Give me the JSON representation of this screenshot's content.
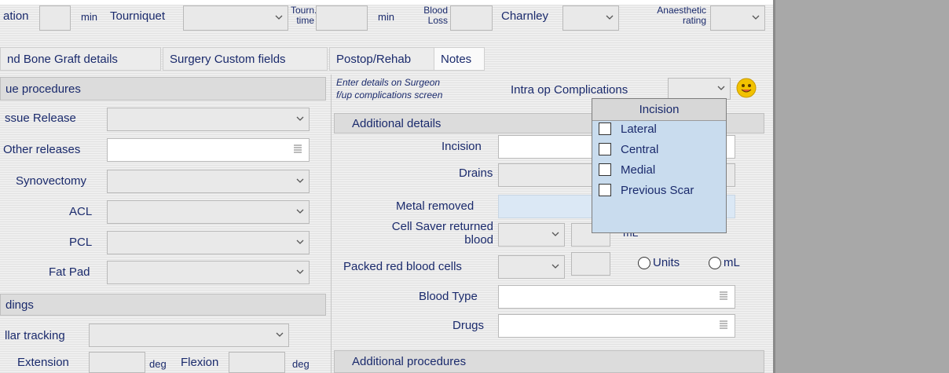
{
  "top_row": {
    "duration_label_fragment": "ation",
    "min_label_1": "min",
    "tourniquet_label": "Tourniquet",
    "tourn_time_label": "Tourn.\ntime",
    "min_label_2": "min",
    "blood_loss_label": "Blood\nLoss",
    "charnley_label": "Charnley",
    "anaesthetic_rating_label": "Anaesthetic\nrating"
  },
  "tabs": [
    {
      "label": "nd Bone Graft details"
    },
    {
      "label": "Surgery Custom fields"
    },
    {
      "label": "Postop/Rehab"
    },
    {
      "label": "Notes"
    }
  ],
  "soft_tissue": {
    "section_title": "ue procedures",
    "rows": [
      {
        "label": "ssue Release"
      },
      {
        "label": "Other releases"
      },
      {
        "label": "Synovectomy"
      },
      {
        "label": "ACL"
      },
      {
        "label": "PCL"
      },
      {
        "label": "Fat Pad"
      }
    ]
  },
  "findings": {
    "section_title": "dings",
    "patellar_tracking_label": "llar tracking",
    "extension_label": "Extension",
    "deg_label_1": "deg",
    "flexion_label": "Flexion",
    "deg_label_2": "deg"
  },
  "complications": {
    "note": "Enter details on Surgeon\nf/up complications screen",
    "intra_op_label": "Intra op Complications"
  },
  "additional_details": {
    "section_title": "Additional details",
    "incision_label": "Incision",
    "drains_label": "Drains",
    "metal_removed_label": "Metal removed",
    "cell_saver_label": "Cell Saver returned\nblood",
    "ml_label": "mL",
    "packed_rbc_label": "Packed red blood cells",
    "units_radio_label": "Units",
    "ml_radio_label": "mL",
    "blood_type_label": "Blood Type",
    "drugs_label": "Drugs"
  },
  "additional_procedures": {
    "section_title": "Additional procedures"
  },
  "incision_popup": {
    "title": "Incision",
    "options": [
      {
        "label": "Lateral",
        "checked": false
      },
      {
        "label": "Central",
        "checked": false
      },
      {
        "label": "Medial",
        "checked": false
      },
      {
        "label": "Previous Scar",
        "checked": false
      }
    ]
  },
  "icons": {
    "dropdown": "chevron-down-icon",
    "list": "list-icon",
    "smiley": "smiley-face-icon"
  },
  "colors": {
    "label_text": "#1a2a6c",
    "popup_bg": "#c9dcee",
    "smiley": "#f2c200"
  }
}
